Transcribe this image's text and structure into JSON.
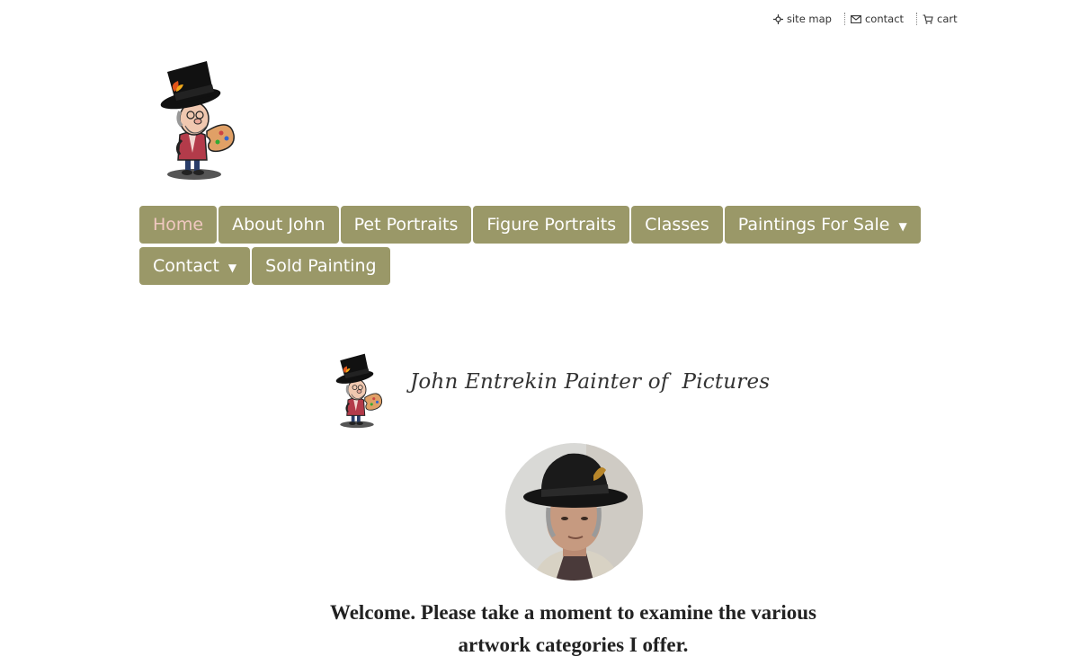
{
  "utility_links": [
    {
      "label": "site map",
      "icon": "sitemap-icon"
    },
    {
      "label": "contact",
      "icon": "envelope-icon"
    },
    {
      "label": "cart",
      "icon": "cart-icon"
    }
  ],
  "nav": {
    "items": [
      {
        "label": "Home",
        "active": true
      },
      {
        "label": "About John"
      },
      {
        "label": "Pet Portraits"
      },
      {
        "label": "Figure Portraits"
      },
      {
        "label": "Classes"
      },
      {
        "label": "Paintings For Sale",
        "dropdown": "▼"
      },
      {
        "label": "Contact",
        "dropdown": "▼"
      },
      {
        "label": "Sold Painting"
      }
    ]
  },
  "banner": {
    "title": "John Entrekin Painter of  Pictures"
  },
  "welcome": {
    "line1": "Welcome. Please take a moment to examine the various",
    "line2": "artwork categories I offer."
  },
  "colors": {
    "nav_bg": "#9a9868",
    "nav_text": "#ffffff",
    "nav_active_text": "#f0c8c0"
  }
}
